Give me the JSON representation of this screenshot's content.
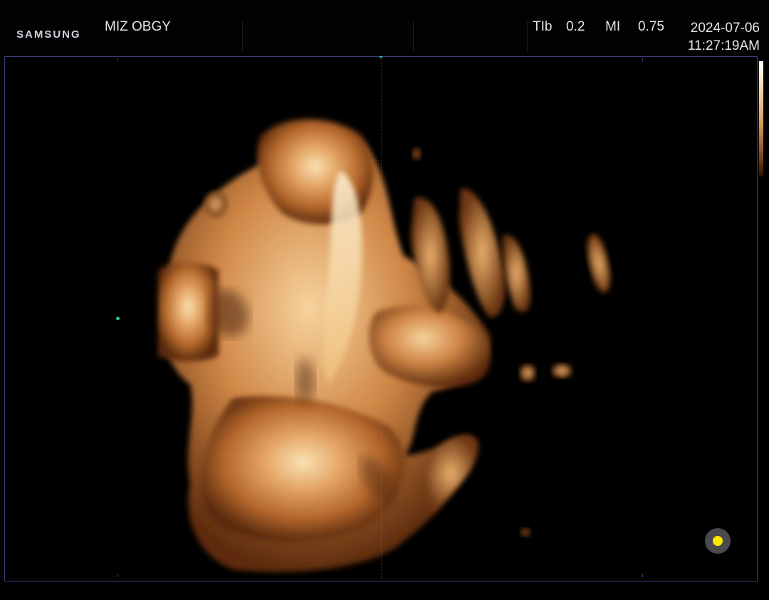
{
  "header": {
    "brand": "SAMSUNG",
    "institution": "MIZ OBGY",
    "params": [
      {
        "label": "TIb",
        "value": "0.2"
      },
      {
        "label": "MI",
        "value": "0.75"
      }
    ],
    "date": "2024-07-06",
    "time": "11:27:19AM"
  },
  "viewport": {
    "mode": "3D surface render",
    "colormap": [
      "#2a1205",
      "#7a3f16",
      "#d9975a",
      "#f6dfb8",
      "#ffffff"
    ],
    "frame_color": "#3a3f7a"
  },
  "status_indicator": {
    "icon": "yellow-status-dot-icon",
    "color": "#ffe600"
  }
}
